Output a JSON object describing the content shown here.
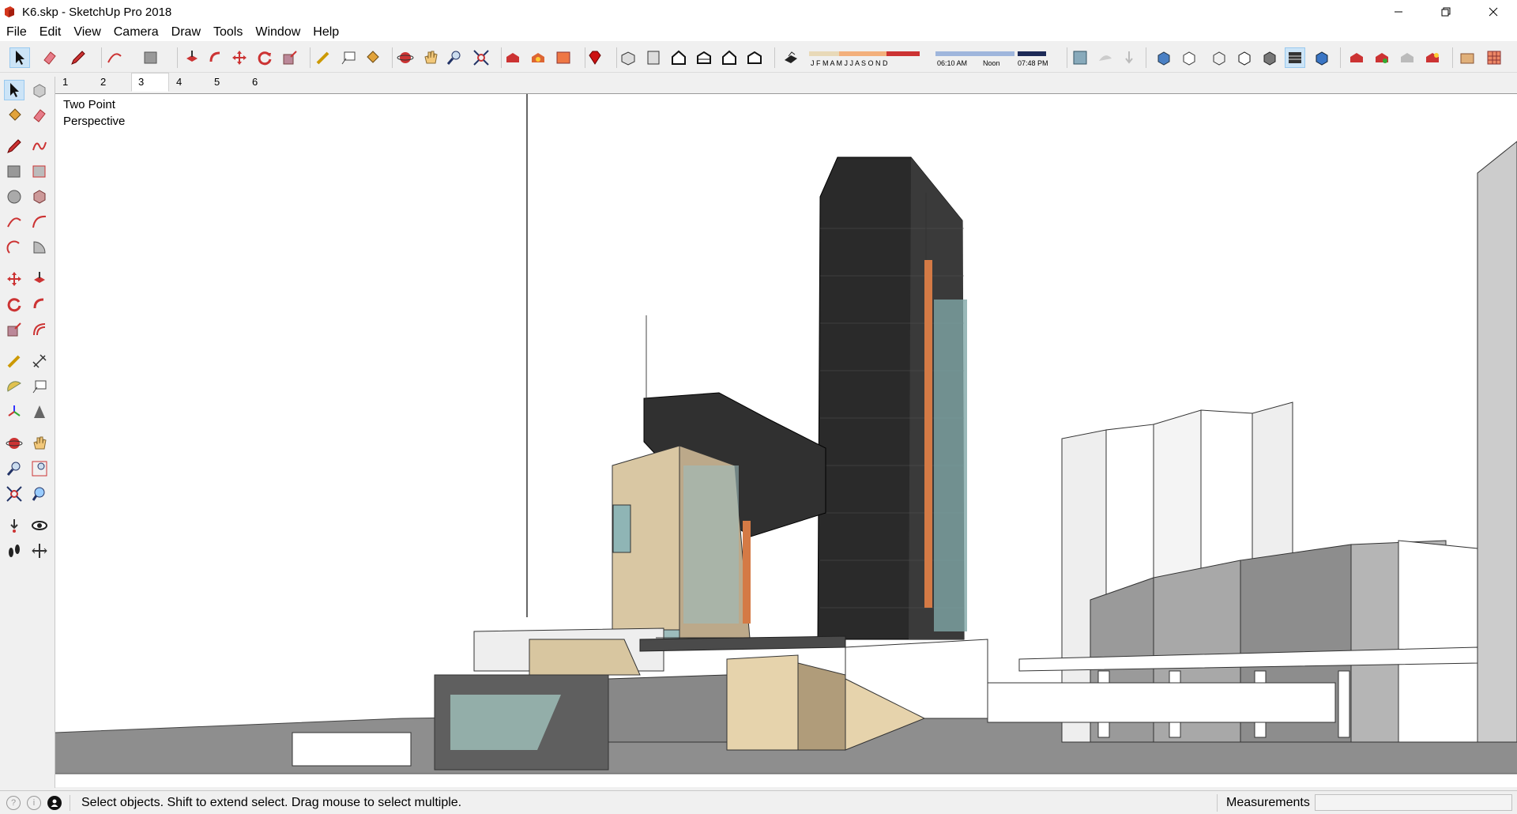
{
  "window": {
    "title": "K6.skp - SketchUp Pro 2018"
  },
  "menu": [
    "File",
    "Edit",
    "View",
    "Camera",
    "Draw",
    "Tools",
    "Window",
    "Help"
  ],
  "scenes": {
    "tabs": [
      "1",
      "2",
      "3",
      "4",
      "5",
      "6"
    ],
    "active_index": 2
  },
  "shadow": {
    "months": "J F M A M J J A S O N D",
    "sunrise": "06:10 AM",
    "noon": "Noon",
    "sunset": "07:48 PM"
  },
  "viewport": {
    "camera_label": "Two Point Perspective"
  },
  "status": {
    "message": "Select objects. Shift to extend select. Drag mouse to select multiple.",
    "measurements_label": "Measurements",
    "measurements_value": ""
  },
  "colors": {
    "selection": "#cce4f7",
    "accent_red": "#c8301e",
    "tower": "#2a2a2a",
    "facade_tan": "#d9c7a3",
    "orange_panels": "#d47a45"
  }
}
